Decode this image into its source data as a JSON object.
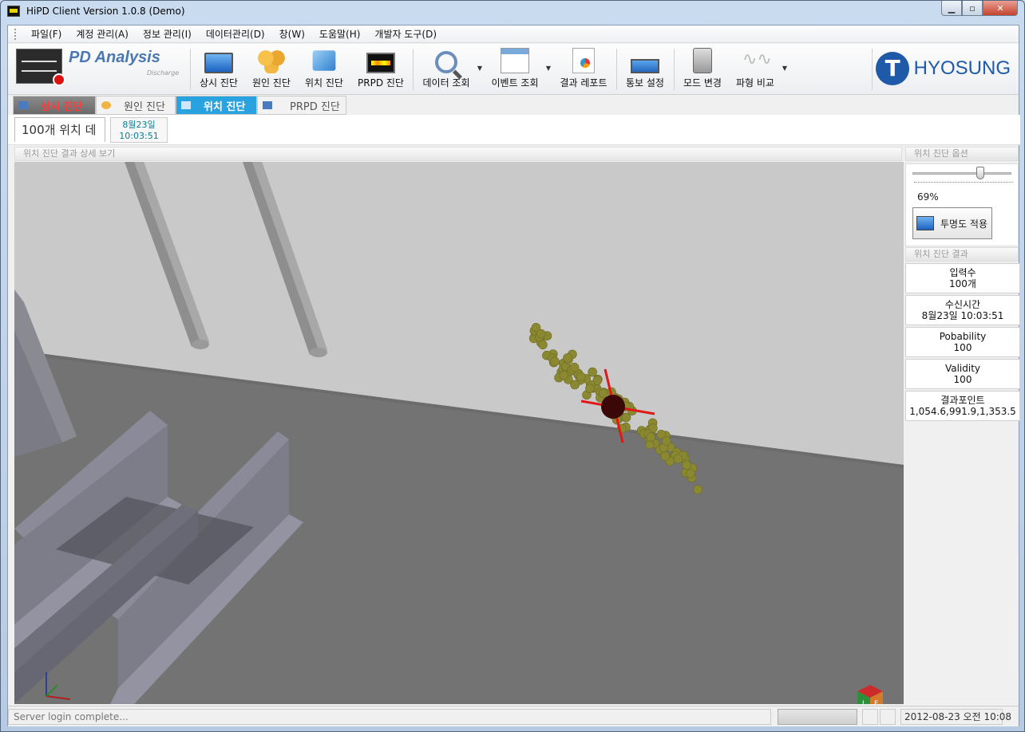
{
  "window": {
    "title": "HiPD Client Version 1.0.8 (Demo)"
  },
  "menu": [
    "파일(F)",
    "계정 관리(A)",
    "정보 관리(I)",
    "데이터관리(D)",
    "창(W)",
    "도움말(H)",
    "개발자 도구(D)"
  ],
  "toolbar": {
    "app_title": "PD Analysis",
    "app_subtitle": "Discharge",
    "buttons": [
      {
        "label": "상시 진단",
        "icon": "monitor-icon"
      },
      {
        "label": "원인 진단",
        "icon": "boxes-icon"
      },
      {
        "label": "위치 진단",
        "icon": "cube-icon"
      },
      {
        "label": "PRPD 진단",
        "icon": "prpd-monitor-icon"
      },
      {
        "label": "데이터 조회",
        "icon": "magnifier-icon"
      },
      {
        "label": "이벤트 조회",
        "icon": "calendar-icon"
      },
      {
        "label": "결과 레포트",
        "icon": "report-icon"
      },
      {
        "label": "통보 설정",
        "icon": "network-icon"
      },
      {
        "label": "모드 변경",
        "icon": "switch-icon"
      },
      {
        "label": "파형 비교",
        "icon": "waveform-icon"
      }
    ],
    "brand": "HYOSUNG"
  },
  "diag_tabs": [
    "상시 진단",
    "원인 진단",
    "위치 진단",
    "PRPD 진단"
  ],
  "subtabs": {
    "active_label": "100개 위치 데",
    "date": "8월23일",
    "time": "10:03:51"
  },
  "view": {
    "header": "위치 진단 결과 상세 보기"
  },
  "options": {
    "header": "위치 진단 옵션",
    "transparency": 0.69,
    "transparency_label": "69%",
    "apply_label": "투명도 적용"
  },
  "results": {
    "header": "위치 진단 결과",
    "cards": [
      {
        "title": "입력수",
        "value": "100개"
      },
      {
        "title": "수신시간",
        "value": "8월23일 10:03:51"
      },
      {
        "title": "Pobability",
        "value": "100"
      },
      {
        "title": "Validity",
        "value": "100"
      },
      {
        "title": "결과포인트",
        "value": "1,054.6,991.9,1,353.5"
      }
    ]
  },
  "status": {
    "message": "Server login complete...",
    "datetime": "2012-08-23 오전 10:08"
  },
  "colors": {
    "accent": "#29a2e0",
    "alert": "#ff3b3b",
    "brand": "#1e5aa8",
    "point": "#8a8830",
    "center": "#3a0606"
  }
}
